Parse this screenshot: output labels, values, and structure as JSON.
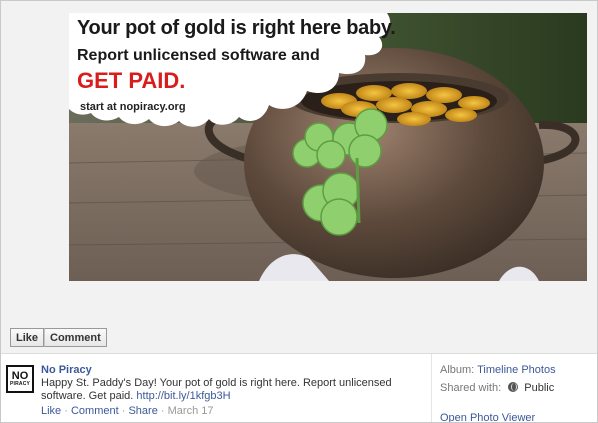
{
  "photo": {
    "headline": "Your pot of gold is right here baby.",
    "line2": "Report unlicensed software and",
    "line3": "GET PAID.",
    "line4": "start at nopiracy.org"
  },
  "actions": {
    "like_label": "Like",
    "comment_label": "Comment"
  },
  "post": {
    "avatar": {
      "big": "NO",
      "small": "PIRACY"
    },
    "author": "No Piracy",
    "text": "Happy St. Paddy's Day! Your pot of gold is right here. Report unlicensed software. Get paid. ",
    "link": "http://bit.ly/1kfgb3H",
    "meta": {
      "like": "Like",
      "comment": "Comment",
      "share": "Share",
      "date": "March 17",
      "sep": "·"
    }
  },
  "side": {
    "album_label": "Album:",
    "album_value": "Timeline Photos",
    "shared_label": "Shared with:",
    "shared_value": "Public",
    "open_viewer": "Open Photo Viewer"
  },
  "colors": {
    "link": "#3b5998",
    "accent_red": "#d91c1c"
  }
}
